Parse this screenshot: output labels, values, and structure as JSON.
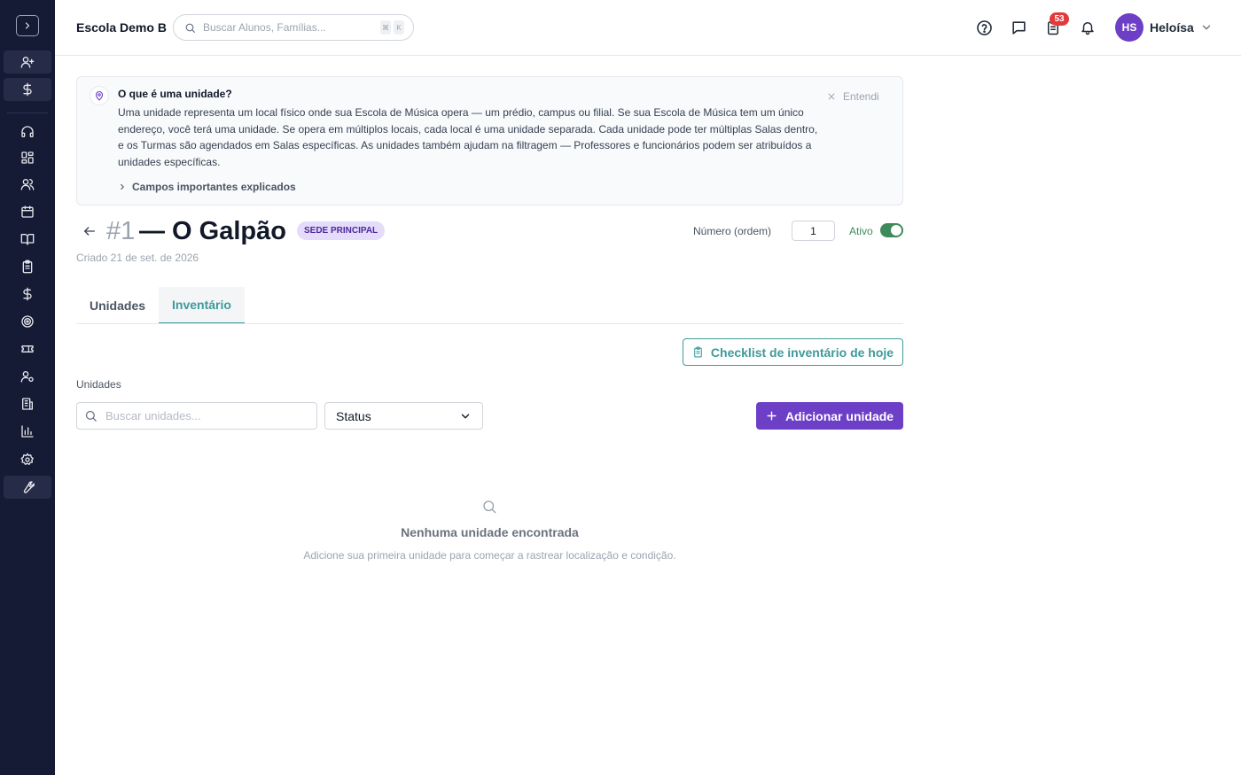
{
  "header": {
    "school_name": "Escola Demo B",
    "search_placeholder": "Buscar Alunos, Famílias...",
    "shortcut_keys": [
      "⌘",
      "K"
    ],
    "tasks_badge_count": "53",
    "user_initials": "HS",
    "user_name": "Heloísa"
  },
  "sidebar": {
    "icons": [
      "chevron-right-icon",
      "user-plus-icon",
      "dollar-icon",
      "headset-icon",
      "dashboard-icon",
      "users-icon",
      "calendar-icon",
      "book-open-icon",
      "clipboard-icon",
      "dollar-icon",
      "target-icon",
      "ticket-icon",
      "user-cog-icon",
      "building-icon",
      "bar-chart-icon",
      "gear-icon",
      "wrench-icon"
    ]
  },
  "info": {
    "title": "O que é uma unidade?",
    "body": "Uma unidade representa um local físico onde sua Escola de Música opera — um prédio, campus ou filial. Se sua Escola de Música tem um único endereço, você terá uma unidade. Se opera em múltiplos locais, cada local é uma unidade separada. Cada unidade pode ter múltiplas Salas dentro, e os Turmas são agendados em Salas específicas. As unidades também ajudam na filtragem — Professores e funcionários podem ser atribuídos a unidades específicas.",
    "dismiss_label": "Entendi",
    "more_label": "Campos importantes explicados"
  },
  "location": {
    "number": "#1",
    "name": "— O Galpão",
    "badge": "SEDE PRINCIPAL",
    "created": "Criado 21 de set. de 2026",
    "order_label": "Número (ordem)",
    "order_value": "1",
    "active_label": "Ativo",
    "active": true
  },
  "tabs": [
    {
      "label": "Unidades",
      "active": false
    },
    {
      "label": "Inventário",
      "active": true
    }
  ],
  "inventory": {
    "checklist_button": "Checklist de inventário de hoje",
    "section_label": "Unidades",
    "search_placeholder": "Buscar unidades...",
    "status_select": "Status",
    "add_button": "Adicionar unidade",
    "empty_title": "Nenhuma unidade encontrada",
    "empty_subtitle": "Adicione sua primeira unidade para começar a rastrear localização e condição."
  },
  "colors": {
    "sidebar_bg": "#151a35",
    "primary": "#6d3fc7",
    "teal": "#3f9a9a",
    "active_green": "#3f8a5a",
    "badge_red": "#e23a3a"
  }
}
